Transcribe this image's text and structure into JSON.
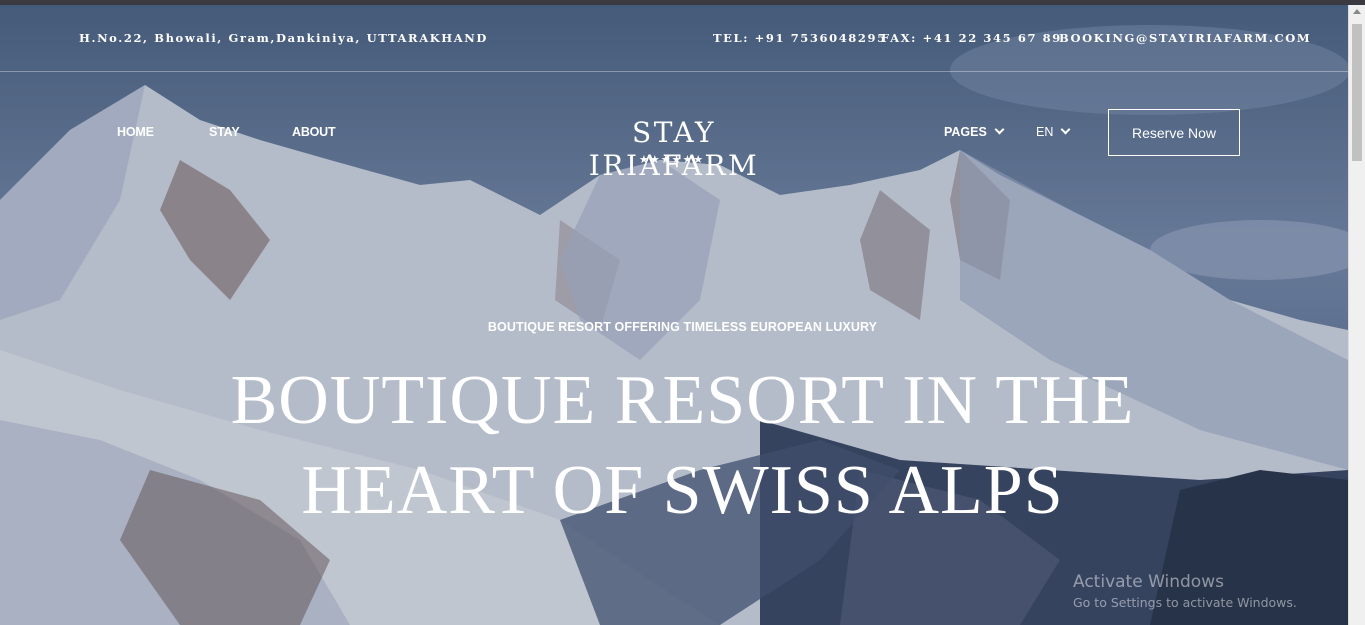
{
  "topbar": {
    "address": "H.No.22, Bhowali, Gram,Dankiniya, UTTARAKHAND",
    "tel": "TEL: +91 7536048295",
    "fax": "FAX: +41 22 345 67 89",
    "email": "BOOKING@STAYIRIAFARM.COM"
  },
  "nav": {
    "home": "HOME",
    "stay": "STAY",
    "about": "ABOUT",
    "pages": "PAGES",
    "language": "EN",
    "reserve": "Reserve Now"
  },
  "logo": {
    "name": "STAY IRIAFARM",
    "stars": "★★★★★★"
  },
  "hero": {
    "eyebrow": "BOUTIQUE RESORT OFFERING TIMELESS EUROPEAN LUXURY",
    "headline_line1": "BOUTIQUE RESORT IN THE",
    "headline_line2": "HEART OF SWISS ALPS"
  },
  "watermark": {
    "title": "Activate Windows",
    "subtitle": "Go to Settings to activate Windows."
  }
}
